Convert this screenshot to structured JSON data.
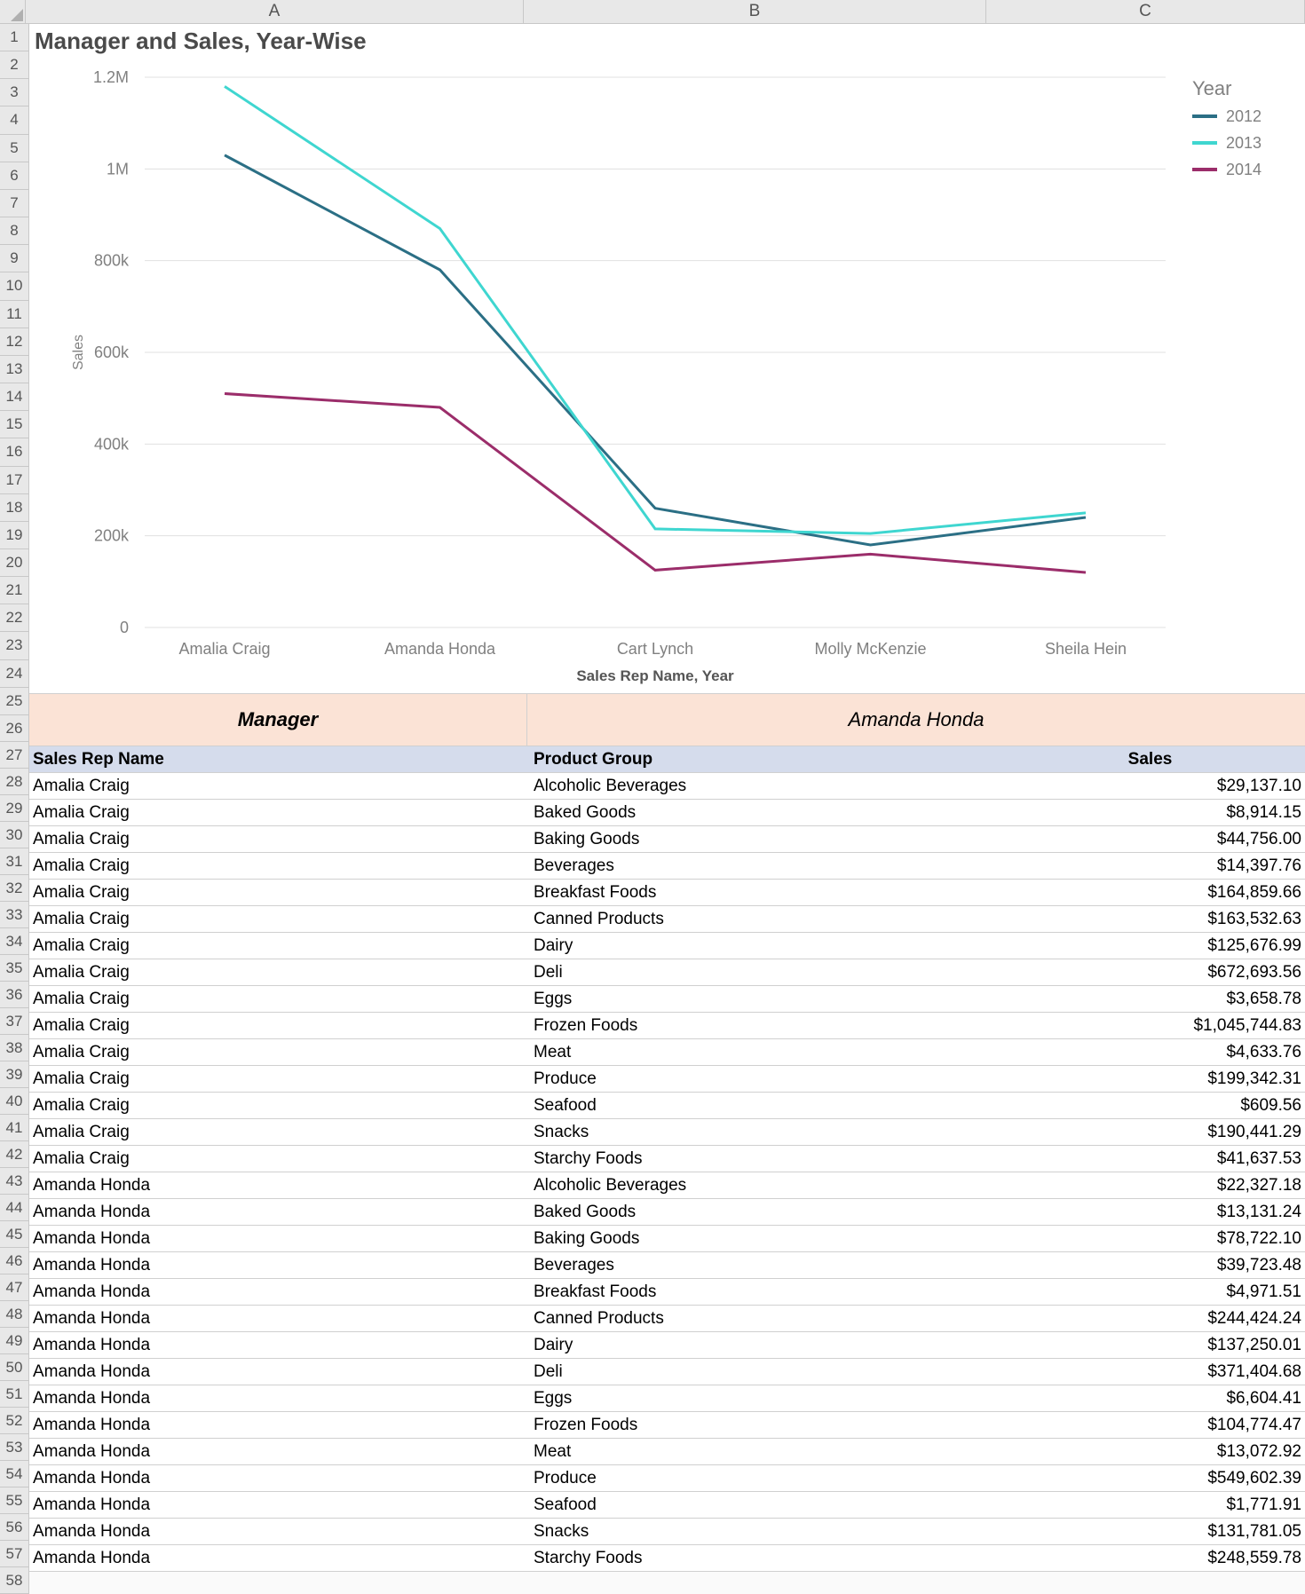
{
  "columns": [
    "A",
    "B",
    "C"
  ],
  "chart_rows": [
    1,
    2,
    3,
    4,
    5,
    6,
    7,
    8,
    9,
    10,
    11,
    12,
    13,
    14,
    15,
    16,
    17,
    18,
    19,
    20,
    21,
    22,
    23,
    24,
    25
  ],
  "chart_data": {
    "type": "line",
    "title": "Manager and Sales, Year-Wise",
    "xlabel": "Sales Rep Name, Year",
    "ylabel": "Sales",
    "ylim": [
      0,
      1200000
    ],
    "yticks": [
      0,
      200000,
      400000,
      600000,
      800000,
      1000000,
      1200000
    ],
    "ytick_labels": [
      "0",
      "200k",
      "400k",
      "600k",
      "800k",
      "1M",
      "1.2M"
    ],
    "categories": [
      "Amalia Craig",
      "Amanda Honda",
      "Cart Lynch",
      "Molly McKenzie",
      "Sheila Hein"
    ],
    "legend_title": "Year",
    "series": [
      {
        "name": "2012",
        "color": "#2b6f85",
        "values": [
          1030000,
          780000,
          260000,
          180000,
          240000
        ]
      },
      {
        "name": "2013",
        "color": "#3fd6d0",
        "values": [
          1180000,
          870000,
          215000,
          205000,
          250000
        ]
      },
      {
        "name": "2014",
        "color": "#9b2d6a",
        "values": [
          510000,
          480000,
          125000,
          160000,
          120000
        ]
      }
    ]
  },
  "manager_row": {
    "label": "Manager",
    "value": "Amanda Honda",
    "row_numbers": [
      26,
      27
    ]
  },
  "table": {
    "start_row": 28,
    "headers": {
      "a": "Sales Rep Name",
      "b": "Product Group",
      "c": "Sales"
    },
    "rows": [
      {
        "a": "Amalia Craig",
        "b": "Alcoholic Beverages",
        "c": "$29,137.10"
      },
      {
        "a": "Amalia Craig",
        "b": "Baked Goods",
        "c": "$8,914.15"
      },
      {
        "a": "Amalia Craig",
        "b": "Baking Goods",
        "c": "$44,756.00"
      },
      {
        "a": "Amalia Craig",
        "b": "Beverages",
        "c": "$14,397.76"
      },
      {
        "a": "Amalia Craig",
        "b": "Breakfast Foods",
        "c": "$164,859.66"
      },
      {
        "a": "Amalia Craig",
        "b": "Canned Products",
        "c": "$163,532.63"
      },
      {
        "a": "Amalia Craig",
        "b": "Dairy",
        "c": "$125,676.99"
      },
      {
        "a": "Amalia Craig",
        "b": "Deli",
        "c": "$672,693.56"
      },
      {
        "a": "Amalia Craig",
        "b": "Eggs",
        "c": "$3,658.78"
      },
      {
        "a": "Amalia Craig",
        "b": "Frozen Foods",
        "c": "$1,045,744.83"
      },
      {
        "a": "Amalia Craig",
        "b": "Meat",
        "c": "$4,633.76"
      },
      {
        "a": "Amalia Craig",
        "b": "Produce",
        "c": "$199,342.31"
      },
      {
        "a": "Amalia Craig",
        "b": "Seafood",
        "c": "$609.56"
      },
      {
        "a": "Amalia Craig",
        "b": "Snacks",
        "c": "$190,441.29"
      },
      {
        "a": "Amalia Craig",
        "b": "Starchy Foods",
        "c": "$41,637.53"
      },
      {
        "a": "Amanda Honda",
        "b": "Alcoholic Beverages",
        "c": "$22,327.18"
      },
      {
        "a": "Amanda Honda",
        "b": "Baked Goods",
        "c": "$13,131.24"
      },
      {
        "a": "Amanda Honda",
        "b": "Baking Goods",
        "c": "$78,722.10"
      },
      {
        "a": "Amanda Honda",
        "b": "Beverages",
        "c": "$39,723.48"
      },
      {
        "a": "Amanda Honda",
        "b": "Breakfast Foods",
        "c": "$4,971.51"
      },
      {
        "a": "Amanda Honda",
        "b": "Canned Products",
        "c": "$244,424.24"
      },
      {
        "a": "Amanda Honda",
        "b": "Dairy",
        "c": "$137,250.01"
      },
      {
        "a": "Amanda Honda",
        "b": "Deli",
        "c": "$371,404.68"
      },
      {
        "a": "Amanda Honda",
        "b": "Eggs",
        "c": "$6,604.41"
      },
      {
        "a": "Amanda Honda",
        "b": "Frozen Foods",
        "c": "$104,774.47"
      },
      {
        "a": "Amanda Honda",
        "b": "Meat",
        "c": "$13,072.92"
      },
      {
        "a": "Amanda Honda",
        "b": "Produce",
        "c": "$549,602.39"
      },
      {
        "a": "Amanda Honda",
        "b": "Seafood",
        "c": "$1,771.91"
      },
      {
        "a": "Amanda Honda",
        "b": "Snacks",
        "c": "$131,781.05"
      },
      {
        "a": "Amanda Honda",
        "b": "Starchy Foods",
        "c": "$248,559.78"
      }
    ]
  }
}
